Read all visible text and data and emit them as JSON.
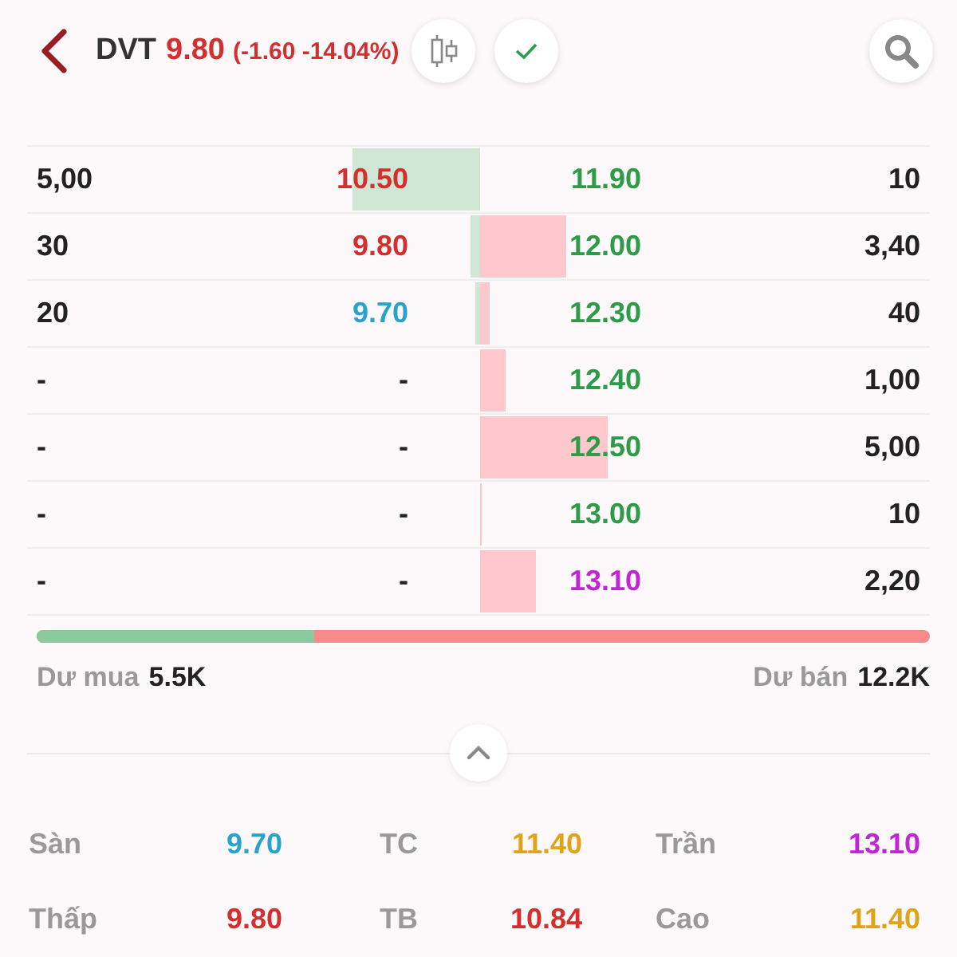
{
  "header": {
    "symbol": "DVT",
    "price": "9.80",
    "change": "(-1.60 -14.04%)"
  },
  "order_book": [
    {
      "bid": {
        "volume": "5,00",
        "price": "10.50",
        "color": "#d32f2f"
      },
      "ask": {
        "price": "11.90",
        "color": "#2e9b48",
        "volume": "10"
      }
    },
    {
      "bid": {
        "volume": "30",
        "price": "9.80",
        "color": "#d32f2f"
      },
      "ask": {
        "price": "12.00",
        "color": "#2e9b48",
        "volume": "3,40"
      }
    },
    {
      "bid": {
        "volume": "20",
        "price": "9.70",
        "color": "#29a3c9"
      },
      "ask": {
        "price": "12.30",
        "color": "#2e9b48",
        "volume": "40"
      }
    },
    {
      "bid": {
        "volume": "-",
        "price": "-",
        "color": "#222222"
      },
      "ask": {
        "price": "12.40",
        "color": "#2e9b48",
        "volume": "1,00"
      }
    },
    {
      "bid": {
        "volume": "-",
        "price": "-",
        "color": "#222222"
      },
      "ask": {
        "price": "12.50",
        "color": "#2e9b48",
        "volume": "5,00"
      }
    },
    {
      "bid": {
        "volume": "-",
        "price": "-",
        "color": "#222222"
      },
      "ask": {
        "price": "13.00",
        "color": "#2e9b48",
        "volume": "10"
      }
    },
    {
      "bid": {
        "volume": "-",
        "price": "-",
        "color": "#222222"
      },
      "ask": {
        "price": "13.10",
        "color": "#c026d3",
        "volume": "2,20"
      }
    }
  ],
  "balance": {
    "level": 0.31,
    "buy_label": "Dư mua",
    "buy_value": "5.5K",
    "sell_label": "Dư bán",
    "sell_value": "12.2K"
  },
  "stats": [
    {
      "label": "Sàn",
      "value": "9.70",
      "color": "#29a3c9"
    },
    {
      "label": "TC",
      "value": "11.40",
      "color": "#e0a418"
    },
    {
      "label": "Trần",
      "value": "13.10",
      "color": "#c026d3"
    },
    {
      "label": "Thấp",
      "value": "9.80",
      "color": "#d32f2f"
    },
    {
      "label": "TB",
      "value": "10.84",
      "color": "#d32f2f"
    },
    {
      "label": "Cao",
      "value": "11.40",
      "color": "#e0a418"
    }
  ]
}
